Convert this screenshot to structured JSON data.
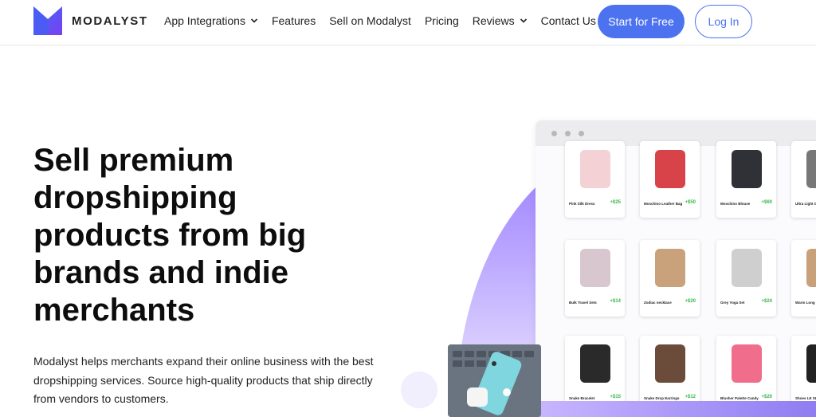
{
  "brand": {
    "name": "MODALYST",
    "logo": "modalyst-logo-icon"
  },
  "nav": {
    "items": [
      {
        "label": "App Integrations",
        "has_dropdown": true
      },
      {
        "label": "Features",
        "has_dropdown": false
      },
      {
        "label": "Sell on Modalyst",
        "has_dropdown": false
      },
      {
        "label": "Pricing",
        "has_dropdown": false
      },
      {
        "label": "Reviews",
        "has_dropdown": true
      },
      {
        "label": "Contact Us",
        "has_dropdown": false
      }
    ],
    "cta_primary": "Start for Free",
    "cta_secondary": "Log In"
  },
  "hero": {
    "title_lines": [
      "Sell premium",
      "dropshipping",
      "products from big",
      "brands and indie",
      "merchants"
    ],
    "description_lines": [
      "Modalyst helps merchants expand their online business with the best",
      "dropshipping services. Source high-quality products that ship directly",
      "from vendors to customers."
    ]
  },
  "products": [
    {
      "name": "Pink Silk Dress",
      "price": "+$25"
    },
    {
      "name": "Moschino Leather Bag",
      "price": "+$50"
    },
    {
      "name": "Moschino Blouse",
      "price": "+$60"
    },
    {
      "name": "Ultra Light G",
      "price": ""
    },
    {
      "name": "Bulk Travel Sets",
      "price": "+$14"
    },
    {
      "name": "Zodiac necklace",
      "price": "+$20"
    },
    {
      "name": "Grey Yoga Set",
      "price": "+$24"
    },
    {
      "name": "Warm Long S",
      "price": ""
    },
    {
      "name": "Snake Bracelet",
      "price": "+$15"
    },
    {
      "name": "Snake Drop Earrings",
      "price": "+$12"
    },
    {
      "name": "Blusher Palette Candy",
      "price": "+$20"
    },
    {
      "name": "Shoes LE SL",
      "price": ""
    }
  ],
  "colors": {
    "accent": "#4c72f0",
    "price_green": "#3ab54a",
    "arc_purple": "#b9a8ff"
  }
}
